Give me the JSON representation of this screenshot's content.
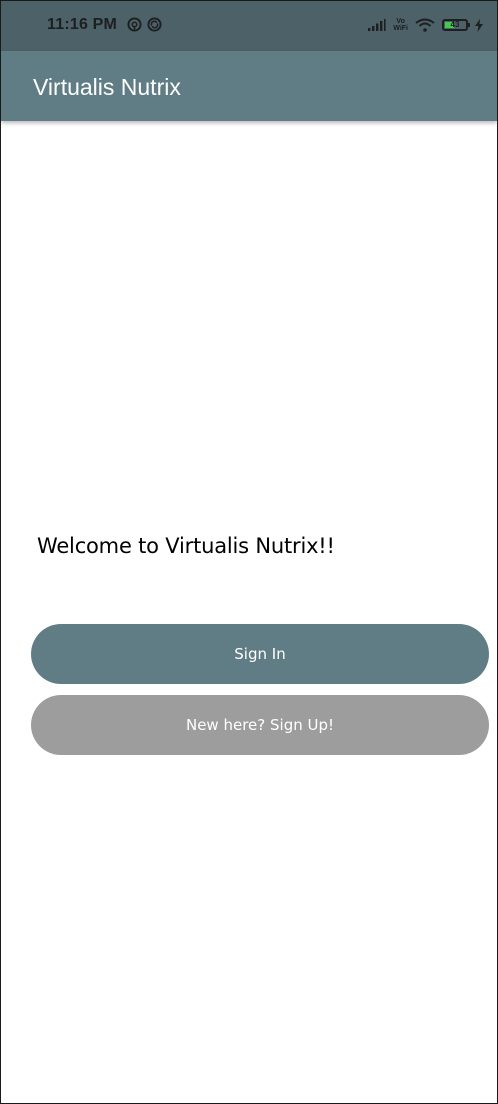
{
  "status_bar": {
    "time": "11:16 PM",
    "notification_icons": [
      "hotspot-notification-icon",
      "sync-notification-icon"
    ],
    "vowifi_top": "Vo",
    "vowifi_bottom": "WiFi",
    "battery_level": "43",
    "battery_fraction": 0.43,
    "right_icons": [
      "signal-icon",
      "vowifi-icon",
      "wifi-icon",
      "battery-icon",
      "charging-icon"
    ]
  },
  "app_bar": {
    "title": "Virtualis Nutrix"
  },
  "main": {
    "welcome_text": "Welcome to Virtualis Nutrix!!",
    "sign_in_label": "Sign In",
    "sign_up_label": "New here? Sign Up!"
  },
  "colors": {
    "status_bar": "#4d6168",
    "app_bar": "#607d86",
    "primary_button": "#607d86",
    "secondary_button": "#9d9d9d",
    "background": "#ffffff",
    "battery_fill": "#45c94b"
  }
}
